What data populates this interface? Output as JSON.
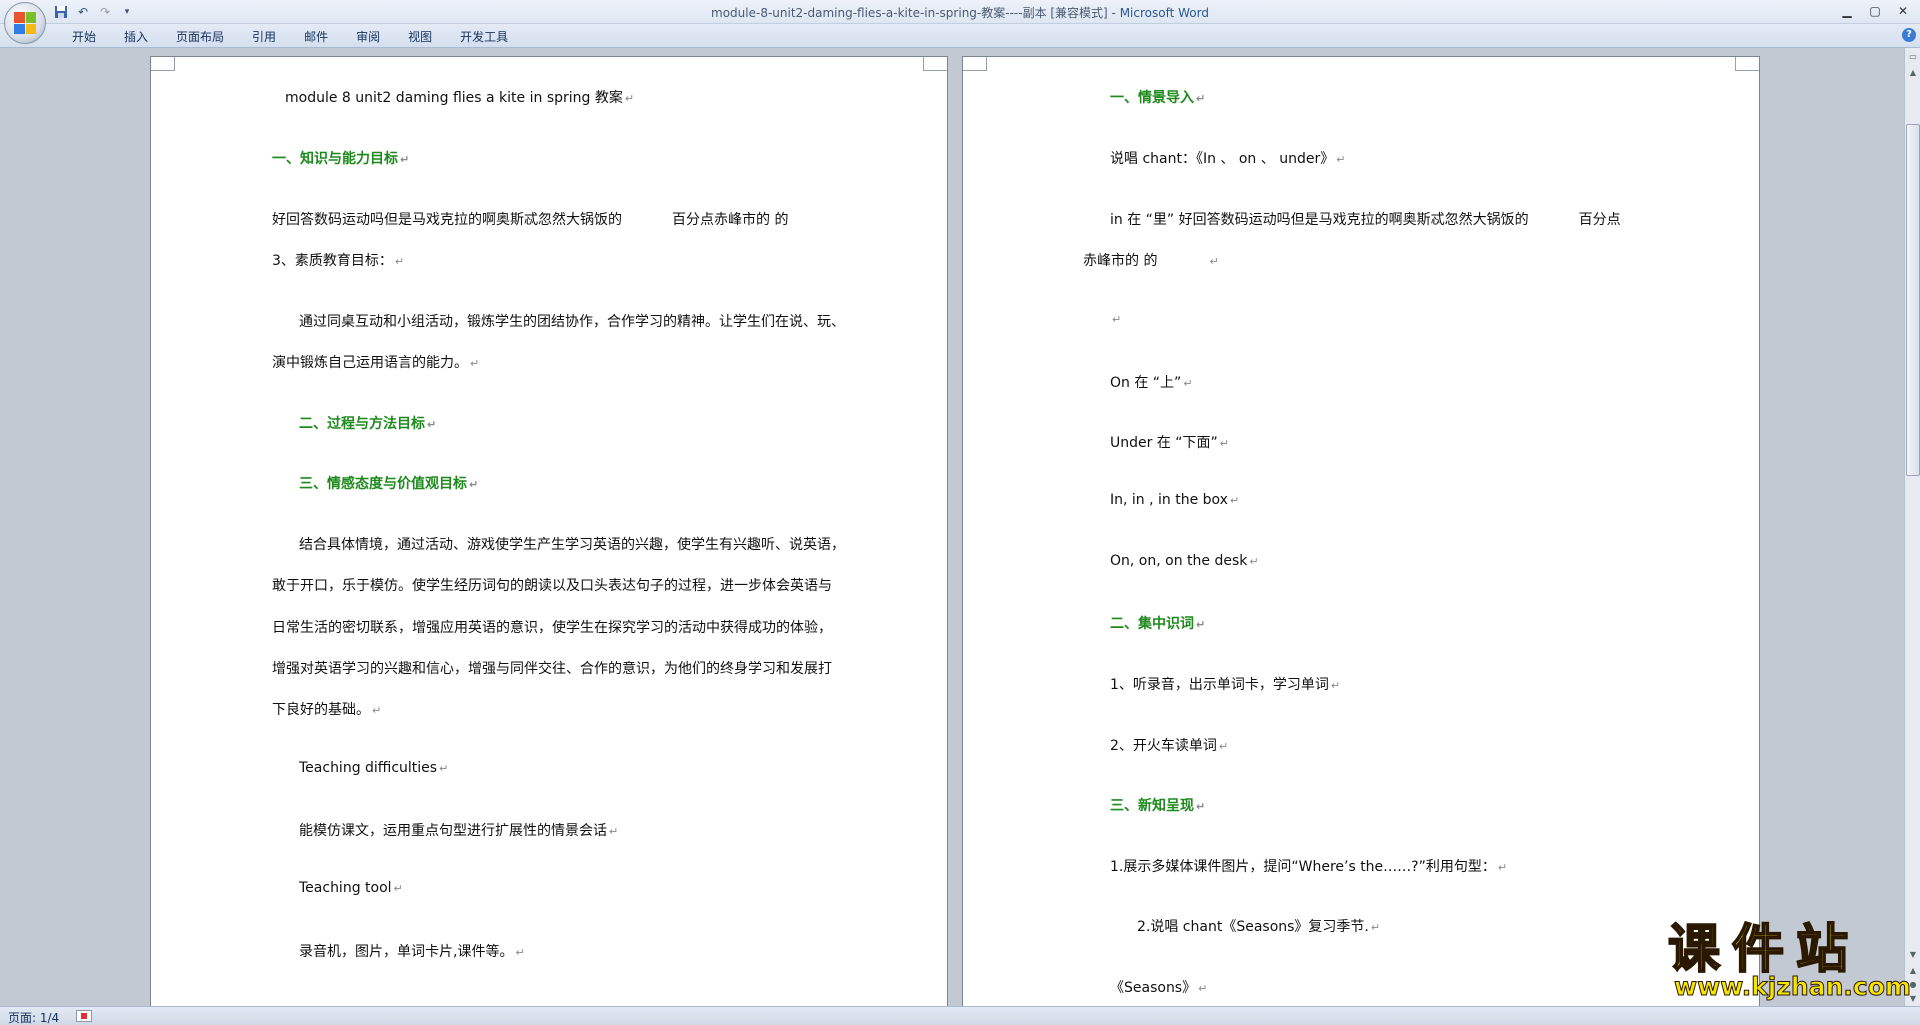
{
  "window": {
    "title_doc": "module-8-unit2-daming-flies-a-kite-in-spring-教案----副本 [兼容模式] - ",
    "title_app": "Microsoft Word"
  },
  "ribbon": {
    "tabs": [
      "开始",
      "插入",
      "页面布局",
      "引用",
      "邮件",
      "审阅",
      "视图",
      "开发工具"
    ]
  },
  "doc": {
    "left_page": {
      "l1": "module 8 unit2 daming  flies a kite in spring  教案",
      "h1": "一、知识与能力目标",
      "p1a": "好回答数码运动吗但是马戏克拉的啊奥斯忒忽然大锅饭的",
      "p1b": "百分点赤峰市的  的",
      "p2": "3、素质教育目标：",
      "p3a": "通过同桌互动和小组活动，锻炼学生的团结协作，合作学习的精神。让学生们在说、玩、",
      "p3b": "演中锻炼自己运用语言的能力。",
      "h2": "二、过程与方法目标",
      "h3": "三、情感态度与价值观目标",
      "p4a": "结合具体情境，通过活动、游戏使学生产生学习英语的兴趣，使学生有兴趣听、说英语，",
      "p4b": "敢于开口，乐于模仿。使学生经历词句的朗读以及口头表达句子的过程，进一步体会英语与",
      "p4c": "日常生活的密切联系，增强应用英语的意识，使学生在探究学习的活动中获得成功的体验，",
      "p4d": "增强对英语学习的兴趣和信心，增强与同伴交往、合作的意识，为他们的终身学习和发展打",
      "p4e": "下良好的基础。",
      "p5": "Teaching difficulties",
      "p6": "能模仿课文，运用重点句型进行扩展性的情景会话",
      "p7": "Teaching tool",
      "p8": "录音机，图片，单词卡片,课件等。"
    },
    "right_page": {
      "h1": "一、情景导入",
      "r1": "说唱 chant：《In  、  on  、  under》",
      "r2a": "in  在  “里” 好回答数码运动吗但是马戏克拉的啊奥斯忒忽然大锅饭的",
      "r2b": "百分点",
      "r3": "赤峰市的  的",
      "r4": "On  在  “上”",
      "r5": "Under  在  “下面”",
      "r6": "In, in , in the box",
      "r7": "On, on,  on the desk",
      "h2": "二、集中识词",
      "r8": "1、听录音，出示单词卡，学习单词",
      "r9": "2、开火车读单词",
      "h3": "三、新知呈现",
      "r10": "1.展示多媒体课件图片，提问“Where’s the……?”利用句型：",
      "r11": "2.说唱 chant《Seasons》复习季节.",
      "r12": "《Seasons》"
    },
    "paragraph_mark": "↵"
  },
  "statusbar": {
    "page": "页面: 1/4"
  },
  "watermark": {
    "cn": "课件站",
    "url": "www.kjzhan.com"
  },
  "colors": {
    "heading_green": "#1e8a1e",
    "watermark_yellow": "#f6e400"
  },
  "icons": [
    "office-button-icon",
    "save-icon",
    "undo-icon",
    "redo-icon",
    "customize-icon",
    "minimize-icon",
    "maximize-icon",
    "close-icon",
    "help-icon"
  ]
}
